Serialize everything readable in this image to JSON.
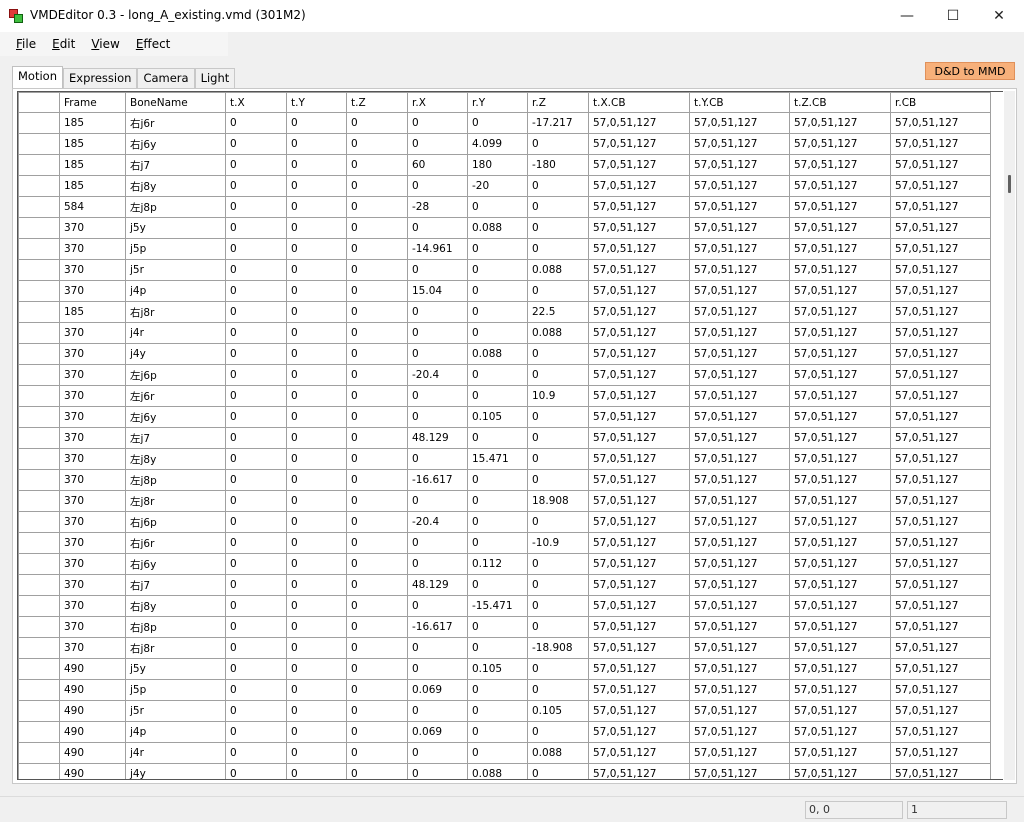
{
  "window": {
    "title": "VMDEditor 0.3 - long_A_existing.vmd (301M2)",
    "minimize": "—",
    "maximize": "☐",
    "close": "✕"
  },
  "menu": [
    {
      "accel": "F",
      "rest": "ile"
    },
    {
      "accel": "E",
      "rest": "dit"
    },
    {
      "accel": "V",
      "rest": "iew"
    },
    {
      "accel": "E",
      "rest": "ffect"
    }
  ],
  "tabs": [
    "Motion",
    "Expression",
    "Camera",
    "Light"
  ],
  "dd_button": "D&D to MMD",
  "table": {
    "columns": [
      "Frame",
      "BoneName",
      "t.X",
      "t.Y",
      "t.Z",
      "r.X",
      "r.Y",
      "r.Z",
      "t.X.CB",
      "t.Y.CB",
      "t.Z.CB",
      "r.CB"
    ],
    "rows": [
      [
        "185",
        "右j6r",
        "0",
        "0",
        "0",
        "0",
        "0",
        "-17.217",
        "57,0,51,127",
        "57,0,51,127",
        "57,0,51,127",
        "57,0,51,127"
      ],
      [
        "185",
        "右j6y",
        "0",
        "0",
        "0",
        "0",
        "4.099",
        "0",
        "57,0,51,127",
        "57,0,51,127",
        "57,0,51,127",
        "57,0,51,127"
      ],
      [
        "185",
        "右j7",
        "0",
        "0",
        "0",
        "60",
        "180",
        "-180",
        "57,0,51,127",
        "57,0,51,127",
        "57,0,51,127",
        "57,0,51,127"
      ],
      [
        "185",
        "右j8y",
        "0",
        "0",
        "0",
        "0",
        "-20",
        "0",
        "57,0,51,127",
        "57,0,51,127",
        "57,0,51,127",
        "57,0,51,127"
      ],
      [
        "584",
        "左j8p",
        "0",
        "0",
        "0",
        "-28",
        "0",
        "0",
        "57,0,51,127",
        "57,0,51,127",
        "57,0,51,127",
        "57,0,51,127"
      ],
      [
        "370",
        "j5y",
        "0",
        "0",
        "0",
        "0",
        "0.088",
        "0",
        "57,0,51,127",
        "57,0,51,127",
        "57,0,51,127",
        "57,0,51,127"
      ],
      [
        "370",
        "j5p",
        "0",
        "0",
        "0",
        "-14.961",
        "0",
        "0",
        "57,0,51,127",
        "57,0,51,127",
        "57,0,51,127",
        "57,0,51,127"
      ],
      [
        "370",
        "j5r",
        "0",
        "0",
        "0",
        "0",
        "0",
        "0.088",
        "57,0,51,127",
        "57,0,51,127",
        "57,0,51,127",
        "57,0,51,127"
      ],
      [
        "370",
        "j4p",
        "0",
        "0",
        "0",
        "15.04",
        "0",
        "0",
        "57,0,51,127",
        "57,0,51,127",
        "57,0,51,127",
        "57,0,51,127"
      ],
      [
        "185",
        "右j8r",
        "0",
        "0",
        "0",
        "0",
        "0",
        "22.5",
        "57,0,51,127",
        "57,0,51,127",
        "57,0,51,127",
        "57,0,51,127"
      ],
      [
        "370",
        "j4r",
        "0",
        "0",
        "0",
        "0",
        "0",
        "0.088",
        "57,0,51,127",
        "57,0,51,127",
        "57,0,51,127",
        "57,0,51,127"
      ],
      [
        "370",
        "j4y",
        "0",
        "0",
        "0",
        "0",
        "0.088",
        "0",
        "57,0,51,127",
        "57,0,51,127",
        "57,0,51,127",
        "57,0,51,127"
      ],
      [
        "370",
        "左j6p",
        "0",
        "0",
        "0",
        "-20.4",
        "0",
        "0",
        "57,0,51,127",
        "57,0,51,127",
        "57,0,51,127",
        "57,0,51,127"
      ],
      [
        "370",
        "左j6r",
        "0",
        "0",
        "0",
        "0",
        "0",
        "10.9",
        "57,0,51,127",
        "57,0,51,127",
        "57,0,51,127",
        "57,0,51,127"
      ],
      [
        "370",
        "左j6y",
        "0",
        "0",
        "0",
        "0",
        "0.105",
        "0",
        "57,0,51,127",
        "57,0,51,127",
        "57,0,51,127",
        "57,0,51,127"
      ],
      [
        "370",
        "左j7",
        "0",
        "0",
        "0",
        "48.129",
        "0",
        "0",
        "57,0,51,127",
        "57,0,51,127",
        "57,0,51,127",
        "57,0,51,127"
      ],
      [
        "370",
        "左j8y",
        "0",
        "0",
        "0",
        "0",
        "15.471",
        "0",
        "57,0,51,127",
        "57,0,51,127",
        "57,0,51,127",
        "57,0,51,127"
      ],
      [
        "370",
        "左j8p",
        "0",
        "0",
        "0",
        "-16.617",
        "0",
        "0",
        "57,0,51,127",
        "57,0,51,127",
        "57,0,51,127",
        "57,0,51,127"
      ],
      [
        "370",
        "左j8r",
        "0",
        "0",
        "0",
        "0",
        "0",
        "18.908",
        "57,0,51,127",
        "57,0,51,127",
        "57,0,51,127",
        "57,0,51,127"
      ],
      [
        "370",
        "右j6p",
        "0",
        "0",
        "0",
        "-20.4",
        "0",
        "0",
        "57,0,51,127",
        "57,0,51,127",
        "57,0,51,127",
        "57,0,51,127"
      ],
      [
        "370",
        "右j6r",
        "0",
        "0",
        "0",
        "0",
        "0",
        "-10.9",
        "57,0,51,127",
        "57,0,51,127",
        "57,0,51,127",
        "57,0,51,127"
      ],
      [
        "370",
        "右j6y",
        "0",
        "0",
        "0",
        "0",
        "0.112",
        "0",
        "57,0,51,127",
        "57,0,51,127",
        "57,0,51,127",
        "57,0,51,127"
      ],
      [
        "370",
        "右j7",
        "0",
        "0",
        "0",
        "48.129",
        "0",
        "0",
        "57,0,51,127",
        "57,0,51,127",
        "57,0,51,127",
        "57,0,51,127"
      ],
      [
        "370",
        "右j8y",
        "0",
        "0",
        "0",
        "0",
        "-15.471",
        "0",
        "57,0,51,127",
        "57,0,51,127",
        "57,0,51,127",
        "57,0,51,127"
      ],
      [
        "370",
        "右j8p",
        "0",
        "0",
        "0",
        "-16.617",
        "0",
        "0",
        "57,0,51,127",
        "57,0,51,127",
        "57,0,51,127",
        "57,0,51,127"
      ],
      [
        "370",
        "右j8r",
        "0",
        "0",
        "0",
        "0",
        "0",
        "-18.908",
        "57,0,51,127",
        "57,0,51,127",
        "57,0,51,127",
        "57,0,51,127"
      ],
      [
        "490",
        "j5y",
        "0",
        "0",
        "0",
        "0",
        "0.105",
        "0",
        "57,0,51,127",
        "57,0,51,127",
        "57,0,51,127",
        "57,0,51,127"
      ],
      [
        "490",
        "j5p",
        "0",
        "0",
        "0",
        "0.069",
        "0",
        "0",
        "57,0,51,127",
        "57,0,51,127",
        "57,0,51,127",
        "57,0,51,127"
      ],
      [
        "490",
        "j5r",
        "0",
        "0",
        "0",
        "0",
        "0",
        "0.105",
        "57,0,51,127",
        "57,0,51,127",
        "57,0,51,127",
        "57,0,51,127"
      ],
      [
        "490",
        "j4p",
        "0",
        "0",
        "0",
        "0.069",
        "0",
        "0",
        "57,0,51,127",
        "57,0,51,127",
        "57,0,51,127",
        "57,0,51,127"
      ],
      [
        "490",
        "j4r",
        "0",
        "0",
        "0",
        "0",
        "0",
        "0.088",
        "57,0,51,127",
        "57,0,51,127",
        "57,0,51,127",
        "57,0,51,127"
      ],
      [
        "490",
        "j4y",
        "0",
        "0",
        "0",
        "0",
        "0.088",
        "0",
        "57,0,51,127",
        "57,0,51,127",
        "57,0,51,127",
        "57,0,51,127"
      ]
    ]
  },
  "status": {
    "coord": "0, 0",
    "count": "1"
  }
}
